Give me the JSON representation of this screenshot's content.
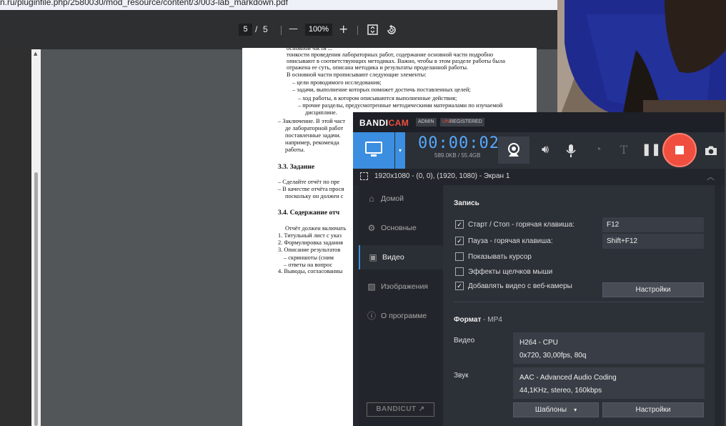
{
  "browser": {
    "url": "n.ru/pluginfile.php/2580030/mod_resource/content/3/003-lab_markdown.pdf"
  },
  "pdf_toolbar": {
    "page_current": "5",
    "page_sep": "/",
    "page_total": "5",
    "zoom_minus": "—",
    "zoom": "100%",
    "zoom_plus": "+"
  },
  "pdf_page": {
    "lines": [
      "основной части ...",
      "тонкости проведения лабораторных работ, содержание основной части подробно",
      "описывают в соответствующих методиках. Важно, чтобы в этом разделе работы была",
      "отражена ее суть, описана методика и результаты проделанной работы.",
      "В основной части прописывают следующие элементы:",
      "–  цели проводимого исследования;",
      "–  задачи, выполнение которых поможет достичь поставленных целей;",
      "–  ход работы, в котором описываются выполненные действия;",
      "–  прочие разделы, предусмотренные методическими материалами по изучаемой",
      "дисциплине.",
      "–  Заключение. В этой част",
      "де лабораторной работ",
      "поставленные задачи.",
      "например, рекоменда",
      "работы.",
      "3.3.   Задание",
      "–  Сделайте отчёт по пре",
      "–  В качестве отчёта прося",
      "поскольку он должен с",
      "3.4.   Содержание отч",
      "Отчёт должен включать",
      "1.  Титульный лист с указ",
      "2.  Формулировка задания",
      "3.  Описание результатов",
      "–  скриншоты (сним",
      "–  ответы на вопрос",
      "4.  Выводы, согласованны"
    ]
  },
  "bandicam": {
    "logo_a": "BANDI",
    "logo_b": "CAM",
    "tag_admin": "ADMIN",
    "tag_unreg_a": "UN",
    "tag_unreg_b": "REGISTERED",
    "timer": "00:00:02",
    "size": "589.0KB / 55.4GB",
    "target": "1920x1080 - (0, 0), (1920, 1080) - Экран 1",
    "nav": [
      {
        "label": "Домой",
        "icon": "home-icon"
      },
      {
        "label": "Основные",
        "icon": "gear-icon"
      },
      {
        "label": "Видео",
        "icon": "video-icon"
      },
      {
        "label": "Изображения",
        "icon": "image-icon"
      },
      {
        "label": "О программе",
        "icon": "info-icon"
      }
    ],
    "bandicut": "BANDICUT ↗",
    "record_section": "Запись",
    "options": [
      {
        "label": "Старт / Стоп - горячая клавиша:",
        "checked": true
      },
      {
        "label": "Пауза - горячая клавиша:",
        "checked": true
      },
      {
        "label": "Показывать курсор",
        "checked": false
      },
      {
        "label": "Эффекты щелчков мыши",
        "checked": false
      },
      {
        "label": "Добавлять видео с веб-камеры",
        "checked": true
      }
    ],
    "hotkey_start": "F12",
    "hotkey_pause": "Shift+F12",
    "settings_btn": "Настройки",
    "format_label": "Формат",
    "format_value": " - MP4",
    "video_label": "Видео",
    "video_codec": "H264 - CPU",
    "video_params": "0x720, 30,00fps, 80q",
    "audio_label": "Звук",
    "audio_codec": "AAC - Advanced Audio Coding",
    "audio_params": "44,1KHz, stereo, 160kbps",
    "templates_btn": "Шаблоны",
    "settings_btn2": "Настройки"
  }
}
